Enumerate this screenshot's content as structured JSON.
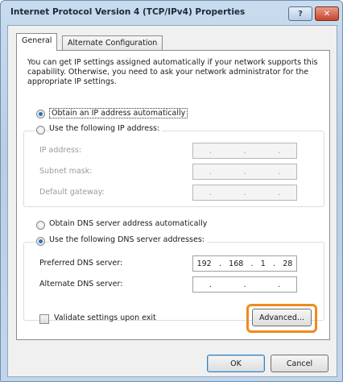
{
  "window": {
    "title": "Internet Protocol Version 4 (TCP/IPv4) Properties",
    "help_label": "?",
    "close_label": "✕"
  },
  "tabs": [
    {
      "label": "General"
    },
    {
      "label": "Alternate Configuration"
    }
  ],
  "info_text": "You can get IP settings assigned automatically if your network supports this capability. Otherwise, you need to ask your network administrator for the appropriate IP settings.",
  "ip": {
    "auto_label": "Obtain an IP address automatically",
    "manual_label": "Use the following IP address:",
    "address_label": "IP address:",
    "subnet_label": "Subnet mask:",
    "gateway_label": "Default gateway:"
  },
  "dns": {
    "auto_label": "Obtain DNS server address automatically",
    "manual_label": "Use the following DNS server addresses:",
    "preferred_label": "Preferred DNS server:",
    "preferred_value": [
      "192",
      "168",
      "1",
      "28"
    ],
    "alternate_label": "Alternate DNS server:"
  },
  "validate_label": "Validate settings upon exit",
  "buttons": {
    "advanced": "Advanced...",
    "ok": "OK",
    "cancel": "Cancel"
  },
  "colors": {
    "highlight": "#f08a1c",
    "radio_dot": "#2d6fc4"
  }
}
